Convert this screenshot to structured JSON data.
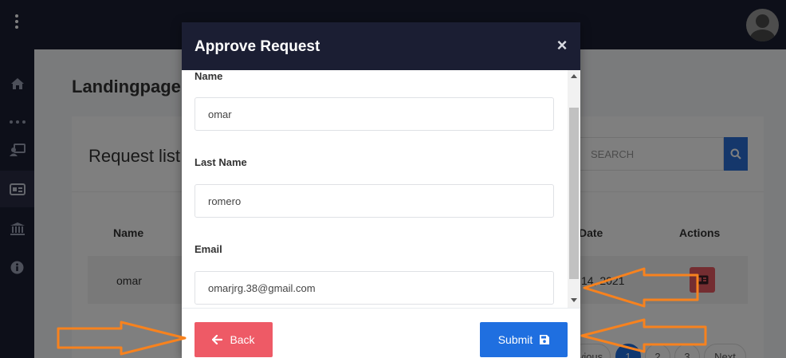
{
  "background": {
    "page_title": "Landingpage",
    "card_title": "Request list",
    "search_placeholder": "SEARCH",
    "table": {
      "headers": [
        "Name",
        "Date",
        "Actions"
      ],
      "row": {
        "name": "omar",
        "date": "14, 2021"
      }
    },
    "pagination": [
      "vious",
      "1",
      "2",
      "3",
      "Next"
    ]
  },
  "modal": {
    "title": "Approve Request",
    "close_label": "×",
    "fields": [
      {
        "label": "Name",
        "value": "omar"
      },
      {
        "label": "Last Name",
        "value": "romero"
      },
      {
        "label": "Email",
        "value": "omarjrg.38@gmail.com"
      }
    ],
    "back_label": "Back",
    "submit_label": "Submit"
  },
  "colors": {
    "header": "#1b1e33",
    "primary": "#1f6fe0",
    "danger": "#ee5a66",
    "annotation": "#f7821e"
  },
  "icons": [
    "kebab-menu-icon",
    "home-icon",
    "monitor-user-icon",
    "id-card-icon",
    "bank-icon",
    "info-icon",
    "search-icon",
    "arrow-left-icon",
    "save-icon"
  ]
}
